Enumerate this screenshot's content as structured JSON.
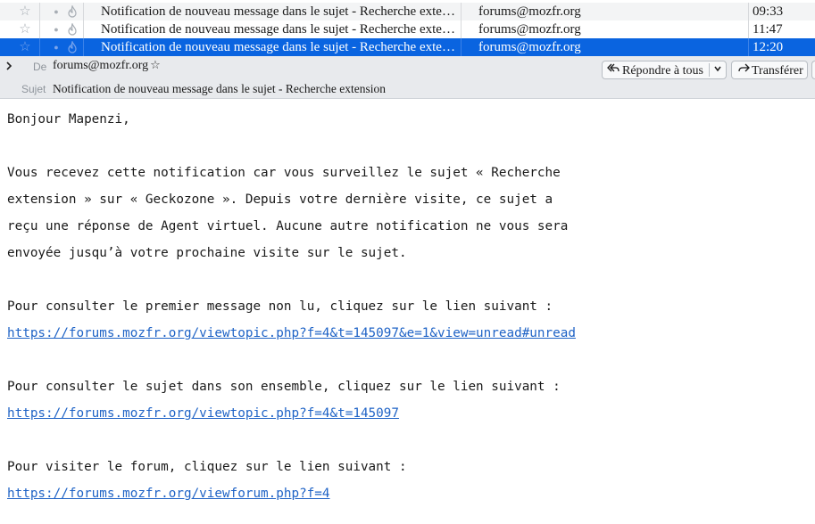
{
  "message_list": [
    {
      "subject": "Notification de nouveau message dans le sujet - Recherche extension",
      "from": "forums@mozfr.org",
      "date": "09:33",
      "selected": false
    },
    {
      "subject": "Notification de nouveau message dans le sujet - Recherche extension",
      "from": "forums@mozfr.org",
      "date": "11:47",
      "selected": false
    },
    {
      "subject": "Notification de nouveau message dans le sujet - Recherche extension",
      "from": "forums@mozfr.org",
      "date": "12:20",
      "selected": true
    }
  ],
  "icons": {
    "star": "star-icon",
    "read": "read-status-dot-icon",
    "junk": "junk-flame-icon",
    "expand": "chevron-right-icon",
    "reply_all": "reply-all-icon",
    "forward": "forward-arrow-icon",
    "dropdown": "chevron-down-icon"
  },
  "header": {
    "from_label": "De",
    "from_value": "forums@mozfr.org",
    "subject_label": "Sujet",
    "subject_value": "Notification de nouveau message dans le sujet - Recherche extension",
    "reply_all_label": "Répondre à tous",
    "forward_label": "Transférer"
  },
  "body": {
    "greeting": "Bonjour Mapenzi,",
    "p1_l1": "Vous recevez cette notification car vous surveillez le sujet « Recherche",
    "p1_l2": "extension » sur « Geckozone ». Depuis votre dernière visite, ce sujet a",
    "p1_l3": "reçu une réponse de Agent virtuel. Aucune autre notification ne vous sera",
    "p1_l4": "envoyée jusqu’à votre prochaine visite sur le sujet.",
    "p2_text": "Pour consulter le premier message non lu, cliquez sur le lien suivant :",
    "p2_link": "https://forums.mozfr.org/viewtopic.php?f=4&t=145097&e=1&view=unread#unread",
    "p3_text": "Pour consulter le sujet dans son ensemble, cliquez sur le lien suivant :",
    "p3_link": "https://forums.mozfr.org/viewtopic.php?f=4&t=145097",
    "p4_text": "Pour visiter le forum, cliquez sur le lien suivant :",
    "p4_link": "https://forums.mozfr.org/viewforum.php?f=4"
  },
  "colors": {
    "selection": "#0a64e0",
    "link": "#1f63c6",
    "header_bg": "#e8eaed"
  }
}
